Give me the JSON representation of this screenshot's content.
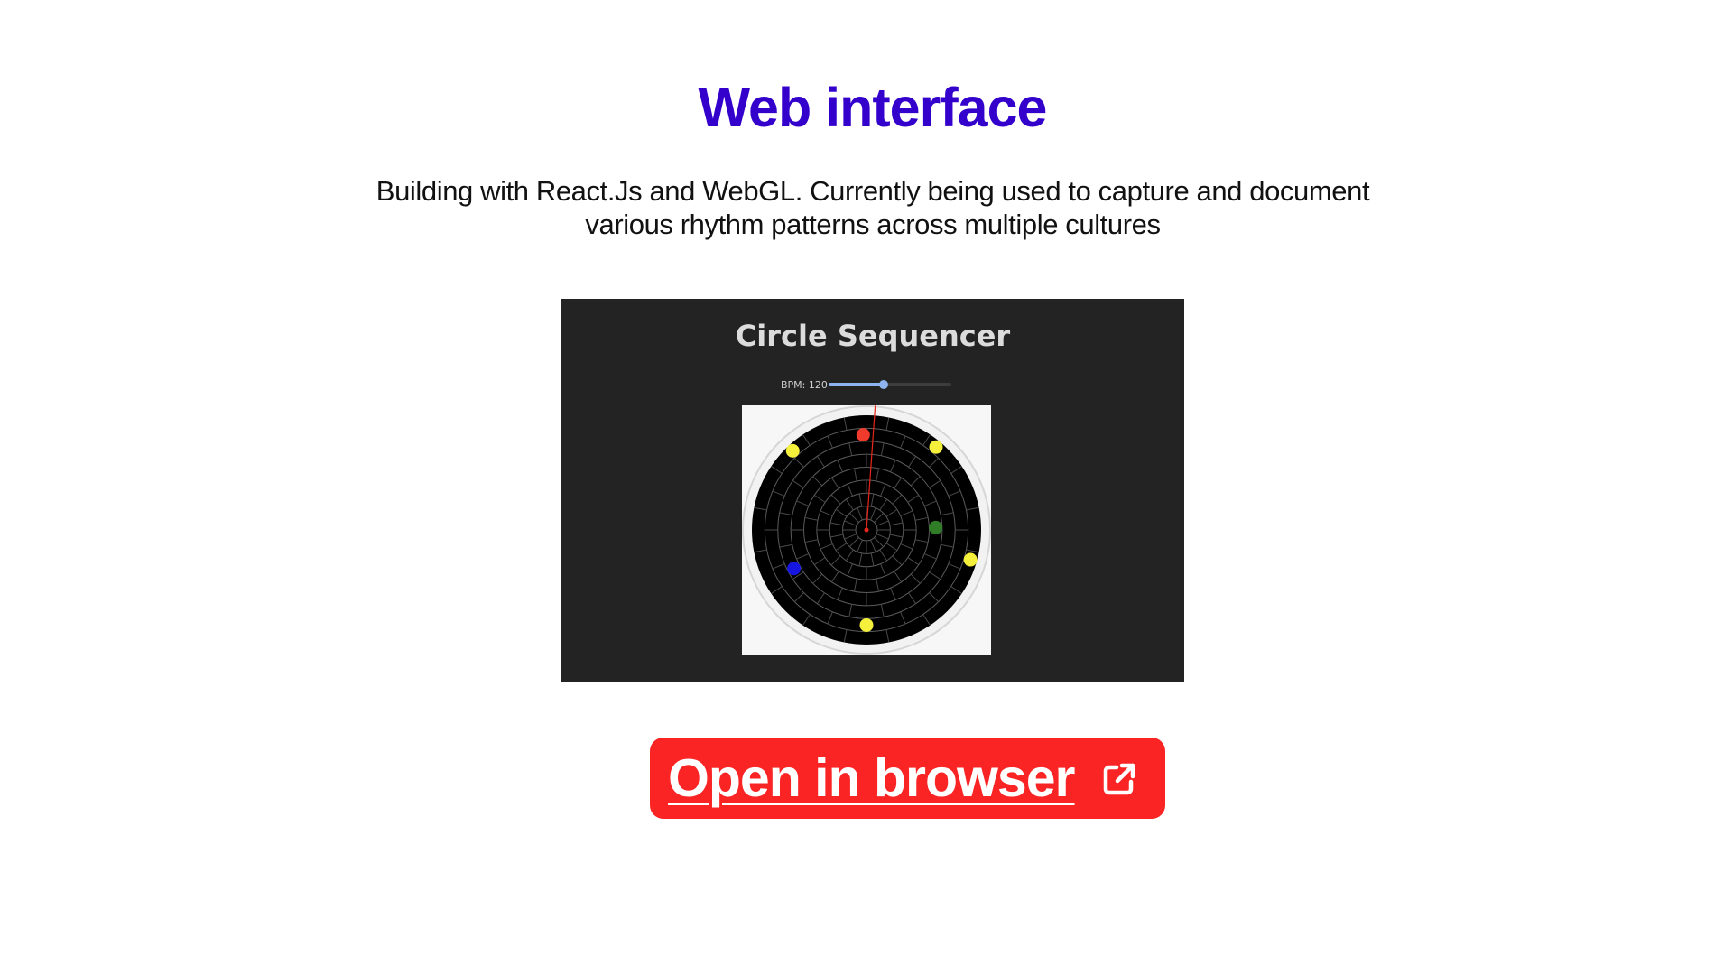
{
  "page": {
    "title": "Web interface",
    "description": "Building with React.Js and WebGL. Currently being used to capture and document various rhythm patterns across multiple cultures"
  },
  "preview": {
    "app_title": "Circle Sequencer",
    "bpm_label": "BPM: 120",
    "bpm_slider_fraction": 0.45,
    "sequencer": {
      "ring_count": 8,
      "steps": 16,
      "playhead_angle_deg": 4,
      "notes": [
        {
          "color": "#f03a2b",
          "ring": 6,
          "angle_deg": -2
        },
        {
          "color": "#f4f03c",
          "ring": 7,
          "angle_deg": -43
        },
        {
          "color": "#f4f03c",
          "ring": 7,
          "angle_deg": 40
        },
        {
          "color": "#2f7d26",
          "ring": 4,
          "angle_deg": 88
        },
        {
          "color": "#f4f03c",
          "ring": 7,
          "angle_deg": 106
        },
        {
          "color": "#1616e0",
          "ring": 5,
          "angle_deg": -118
        },
        {
          "color": "#f4f03c",
          "ring": 6,
          "angle_deg": 180
        }
      ]
    }
  },
  "cta": {
    "label": "Open in browser",
    "icon": "external-link-icon",
    "color": "#fa2424"
  },
  "colors": {
    "title": "#3300cc",
    "preview_background": "#232323",
    "slider_accent": "#8db4f0",
    "playhead": "#e8261a"
  }
}
